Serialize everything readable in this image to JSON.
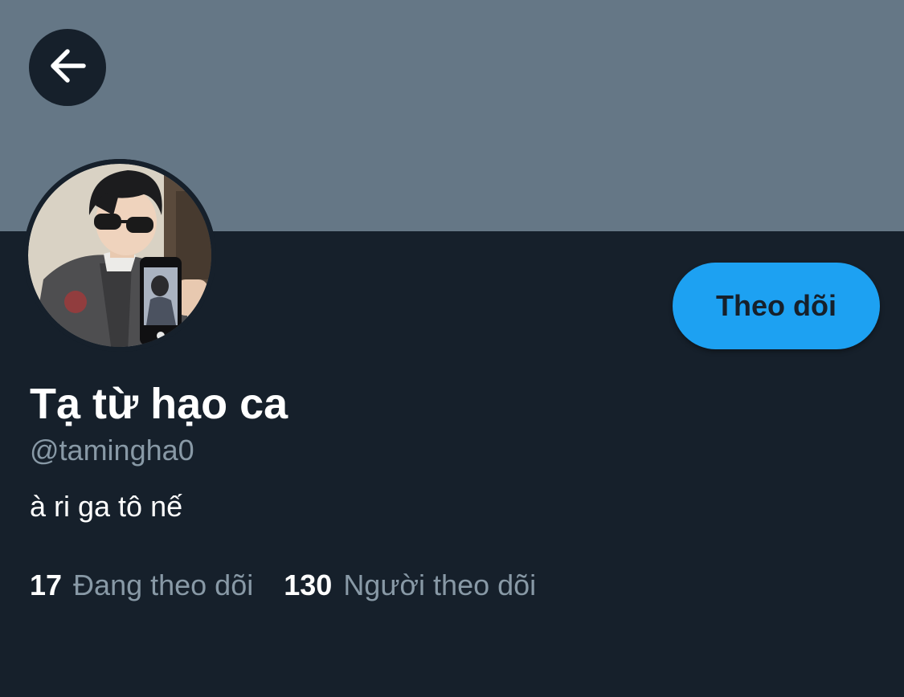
{
  "header": {
    "back_icon": "arrow-left-icon",
    "banner_color": "#657786"
  },
  "profile": {
    "display_name": "Tạ từ hạo ca",
    "handle": "@tamingha0",
    "bio": "à ri ga tô nế",
    "follow_label": "Theo dõi",
    "accent_color": "#1da1f2",
    "background_color": "#16202b"
  },
  "stats": {
    "following_count": "17",
    "following_label": "Đang theo dõi",
    "followers_count": "130",
    "followers_label": "Người theo dõi"
  }
}
